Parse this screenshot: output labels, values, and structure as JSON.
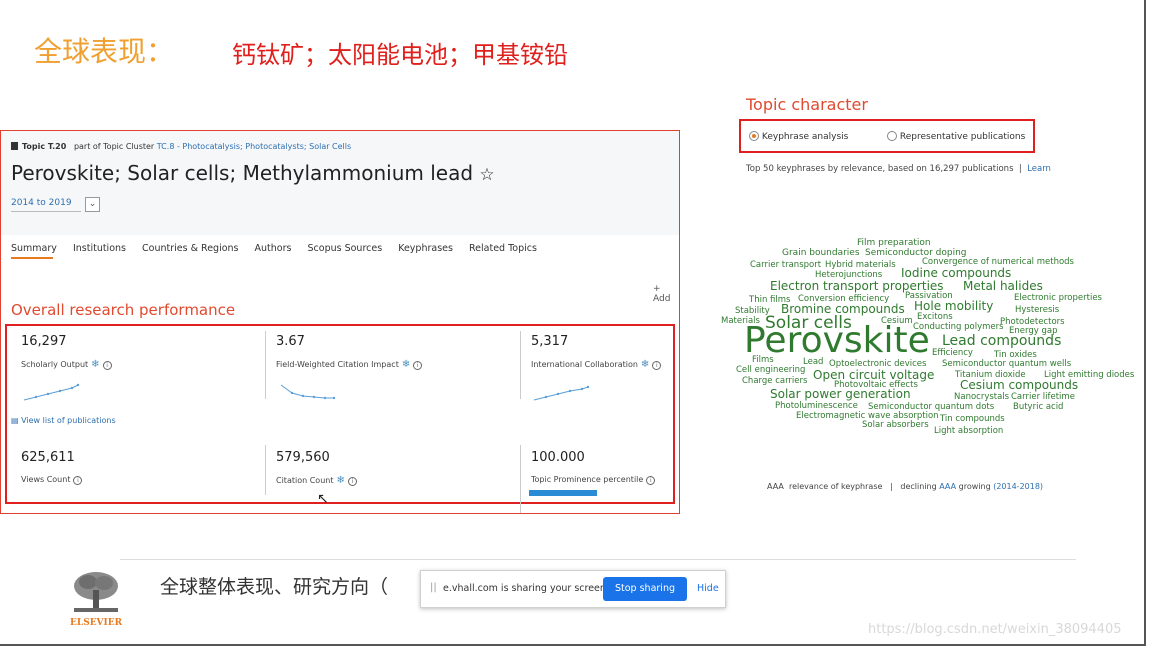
{
  "slide": {
    "title": "全球表现：",
    "subtitle": "钙钛矿；太阳能电池；甲基铵铅",
    "bottom_caption": "全球整体表现、研究方向（",
    "watermark": "https://blog.csdn.net/weixin_38094405"
  },
  "colors": {
    "title_orange": "#f0a030",
    "subtitle_red": "#e0201c",
    "highlight_box": "#e02020",
    "link_blue": "#2e6fb0",
    "keyword_green": "#2f7a2f",
    "stop_button": "#1a73e8"
  },
  "topic": {
    "badge": "Topic T.20",
    "cluster_prefix": "part of Topic Cluster",
    "cluster_link": "TC.8 - Photocatalysis; Photocatalysts; Solar Cells",
    "title": "Perovskite; Solar cells; Methylammonium lead",
    "favorite_icon": "☆",
    "year_range": "2014 to 2019",
    "dropdown_icon": "⌄",
    "tabs": [
      "Summary",
      "Institutions",
      "Countries & Regions",
      "Authors",
      "Scopus Sources",
      "Keyphrases",
      "Related Topics"
    ],
    "add_label": "+ Add"
  },
  "performance": {
    "heading": "Overall research performance",
    "view_list": "View list of publications",
    "metrics": [
      {
        "value": "16,297",
        "label": "Scholarly Output"
      },
      {
        "value": "3.67",
        "label": "Field-Weighted Citation Impact"
      },
      {
        "value": "5,317",
        "label": "International Collaboration"
      },
      {
        "value": "625,611",
        "label": "Views Count"
      },
      {
        "value": "579,560",
        "label": "Citation Count"
      },
      {
        "value": "100.000",
        "label": "Topic Prominence percentile"
      }
    ],
    "prominence_percent": 100,
    "info_icon": "i",
    "snowflake_icon": "❄"
  },
  "topic_character": {
    "heading": "Topic character",
    "options": [
      {
        "label": "Keyphrase analysis",
        "selected": true
      },
      {
        "label": "Representative publications",
        "selected": false
      }
    ],
    "note": "Top 50 keyphrases by relevance, based on 16,297 publications",
    "learn": "Learn",
    "keyphrases": [
      "Film preparation",
      "Grain boundaries",
      "Semiconductor doping",
      "Carrier transport",
      "Hybrid materials",
      "Convergence of numerical methods",
      "Heterojunctions",
      "Iodine compounds",
      "Electron transport properties",
      "Metal halides",
      "Passivation",
      "Thin films",
      "Conversion efficiency",
      "Electronic properties",
      "Stability",
      "Bromine compounds",
      "Hole mobility",
      "Hysteresis",
      "Materials",
      "Excitons",
      "Solar cells",
      "Cesium",
      "Photodetectors",
      "Conducting polymers",
      "Energy gap",
      "Perovskite",
      "Lead compounds",
      "Efficiency",
      "Tin oxides",
      "Films",
      "Lead",
      "Optoelectronic devices",
      "Semiconductor quantum wells",
      "Cell engineering",
      "Open circuit voltage",
      "Titanium dioxide",
      "Light emitting diodes",
      "Charge carriers",
      "Photovoltaic effects",
      "Cesium compounds",
      "Solar power generation",
      "Nanocrystals",
      "Carrier lifetime",
      "Photoluminescence",
      "Semiconductor quantum dots",
      "Butyric acid",
      "Electromagnetic wave absorption",
      "Tin compounds",
      "Solar absorbers",
      "Light absorption"
    ],
    "legend": {
      "sizes": "AAA",
      "relevance": "relevance of keyphrase",
      "separator": "|",
      "declining": "declining",
      "growing": "growing",
      "range": "(2014-2018)"
    }
  },
  "share_bar": {
    "grip": "||",
    "text": "e.vhall.com is sharing your screen.",
    "stop": "Stop sharing",
    "hide": "Hide"
  },
  "logo": {
    "text": "ELSEVIER",
    "icon": "elsevier-tree"
  }
}
